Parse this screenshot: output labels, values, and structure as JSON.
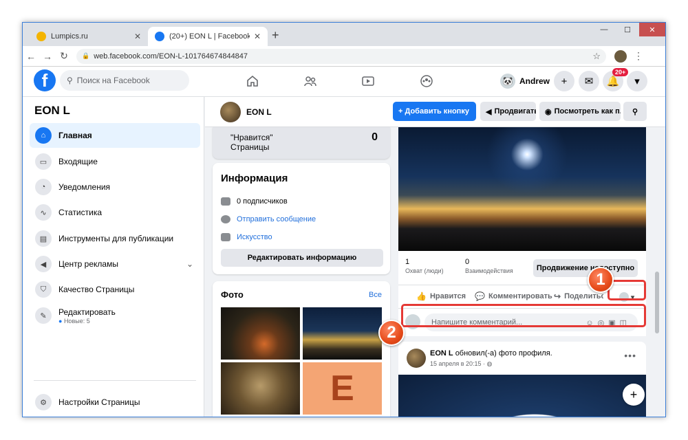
{
  "browser": {
    "tabs": [
      {
        "title": "Lumpics.ru",
        "active": false
      },
      {
        "title": "(20+) EON L | Facebook",
        "active": true
      }
    ],
    "url": "web.facebook.com/EON-L-101764674844847"
  },
  "fb_header": {
    "search_placeholder": "Поиск на Facebook",
    "user_name": "Andrew",
    "notification_badge": "20+"
  },
  "sidebar": {
    "page_name": "EON L",
    "items": [
      {
        "label": "Главная",
        "icon": "home-icon",
        "active": true
      },
      {
        "label": "Входящие",
        "icon": "inbox-icon"
      },
      {
        "label": "Уведомления",
        "icon": "bell-icon"
      },
      {
        "label": "Статистика",
        "icon": "stats-icon"
      },
      {
        "label": "Инструменты для публикации",
        "icon": "publishing-tools-icon"
      },
      {
        "label": "Центр рекламы",
        "icon": "megaphone-icon"
      },
      {
        "label": "Качество Страницы",
        "icon": "shield-icon"
      },
      {
        "label": "Редактировать",
        "icon": "pencil-icon",
        "sub": "Новые: 5"
      }
    ],
    "settings_label": "Настройки Страницы"
  },
  "page_header": {
    "page_name": "EON L",
    "add_button": "+ Добавить кнопку",
    "promote_button": "Продвигать",
    "view_as_button": "Посмотреть как п..."
  },
  "likes_card": {
    "label_line1": "\"Нравится\"",
    "label_line2": "Страницы",
    "count": "0"
  },
  "info_card": {
    "title": "Информация",
    "followers": "0 подписчиков",
    "send_message": "Отправить сообщение",
    "category": "Искусство",
    "edit_button": "Редактировать информацию"
  },
  "photos_card": {
    "title": "Фото",
    "all_link": "Все",
    "tile_letter": "E"
  },
  "post": {
    "reach_value": "1",
    "reach_label": "Охват (люди)",
    "engagement_value": "0",
    "engagement_label": "Взаимодействия",
    "promote_label": "Продвижение недоступно",
    "like_label": "Нравится",
    "comment_label": "Комментировать",
    "share_label": "Поделиться",
    "comment_placeholder": "Напишите комментарий..."
  },
  "post2": {
    "author": "EON L",
    "action_text": "обновил(-а) фото профиля.",
    "timestamp": "15 апреля в 20:15 ·"
  },
  "annotations": {
    "marker1": "1",
    "marker2": "2",
    "color": "#e53935"
  },
  "colors": {
    "fb_blue": "#1877f2",
    "link": "#216fdb",
    "highlight": "#e53935"
  }
}
